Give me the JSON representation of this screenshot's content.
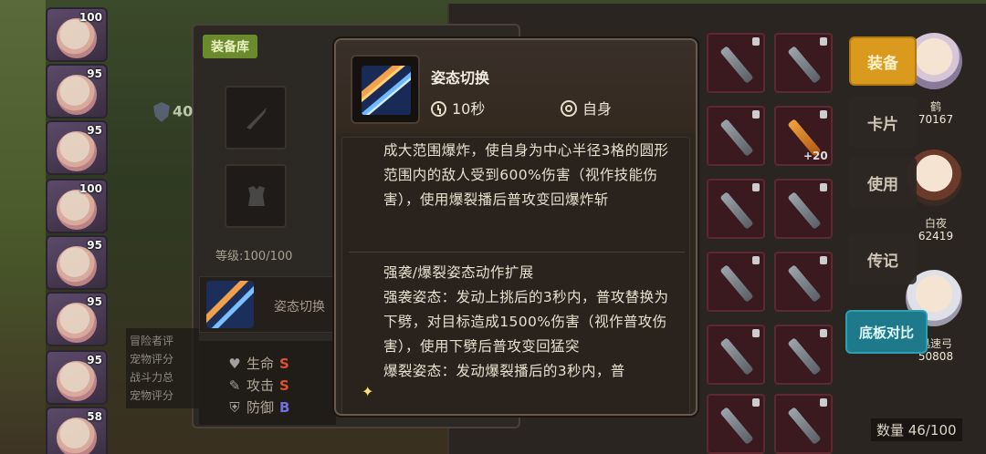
{
  "roster": [
    {
      "level": "100"
    },
    {
      "level": "95"
    },
    {
      "level": "95"
    },
    {
      "level": "100"
    },
    {
      "level": "95"
    },
    {
      "level": "95"
    },
    {
      "level": "95"
    },
    {
      "level": "58"
    }
  ],
  "storage": {
    "tab_label": "装备库",
    "power_value": "40",
    "level_text": "等级:100/100",
    "skill_row_name": "姿态切换",
    "stats": [
      {
        "name": "生命",
        "grade": "S"
      },
      {
        "name": "攻击",
        "grade": "S"
      },
      {
        "name": "防御",
        "grade": "B"
      }
    ],
    "side_text": [
      "冒险者评",
      "宠物评分",
      "战斗力总",
      "宠物评分"
    ]
  },
  "inventory": {
    "plus_label": "+20",
    "count_text": "数量 46/100"
  },
  "menu": {
    "equip": "装备",
    "card": "卡片",
    "use": "使用",
    "legend": "传记",
    "compare": "底板对比"
  },
  "characters": [
    {
      "name": "鹤",
      "power": "70167"
    },
    {
      "name": "白夜",
      "power": "62419"
    },
    {
      "name": "迅速弓",
      "power": "50808"
    }
  ],
  "tooltip": {
    "skill_name": "姿态切换",
    "cooldown": "10秒",
    "target": "自身",
    "paragraph1": "成大范围爆炸，使自身为中心半径3格的圆形范围内的敌人受到600%伤害（视作技能伤害），使用爆裂播后普攻变回爆炸斩",
    "paragraph2": "强袭/爆裂姿态动作扩展\n强袭姿态：发动上挑后的3秒内，普攻替换为下劈，对目标造成1500%伤害（视作普攻伤害），使用下劈后普攻变回猛突\n爆裂姿态：发动爆裂播后的3秒内，普",
    "star": "✦"
  }
}
